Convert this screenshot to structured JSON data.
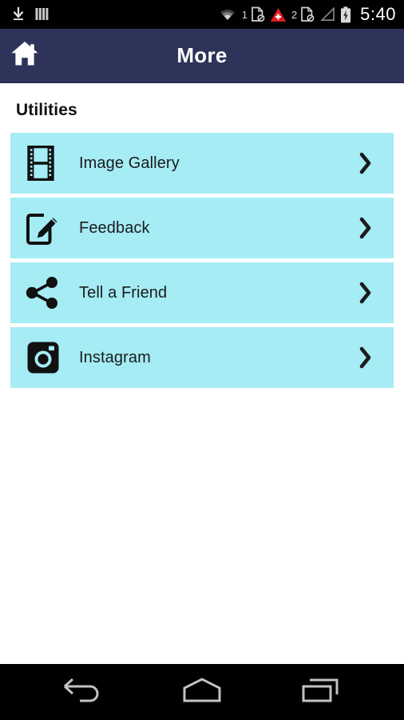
{
  "status_bar": {
    "left_icons": [
      {
        "name": "download-icon",
        "label": "download"
      },
      {
        "name": "sim-bars-icon",
        "label": "sim-bars"
      }
    ],
    "right_icons": [
      {
        "name": "wifi-icon",
        "label": "wifi"
      },
      {
        "name": "sim1-no-service-icon",
        "label": "1"
      },
      {
        "name": "alert-triangle-icon",
        "label": "alert"
      },
      {
        "name": "sim2-no-service-icon",
        "label": "2"
      },
      {
        "name": "signal-strength-icon",
        "label": "signal"
      },
      {
        "name": "battery-charging-icon",
        "label": "battery"
      }
    ],
    "sim1_number": "1",
    "sim2_number": "2",
    "clock": "5:40"
  },
  "app_bar": {
    "home_icon": "home-icon",
    "title": "More",
    "background_color": "#2d3359",
    "title_color": "#ffffff"
  },
  "main": {
    "section_title": "Utilities",
    "item_background_color": "#a5ecf5",
    "items": [
      {
        "icon": "film-strip-icon",
        "label": "Image Gallery",
        "chevron": "chevron-right-icon"
      },
      {
        "icon": "edit-pencil-icon",
        "label": "Feedback",
        "chevron": "chevron-right-icon"
      },
      {
        "icon": "share-icon",
        "label": "Tell a Friend",
        "chevron": "chevron-right-icon"
      },
      {
        "icon": "instagram-camera-icon",
        "label": "Instagram",
        "chevron": "chevron-right-icon"
      }
    ]
  },
  "nav_bar": {
    "back_icon": "back-arrow-icon",
    "home_icon": "home-pentagon-icon",
    "recents_icon": "recent-apps-icon"
  }
}
